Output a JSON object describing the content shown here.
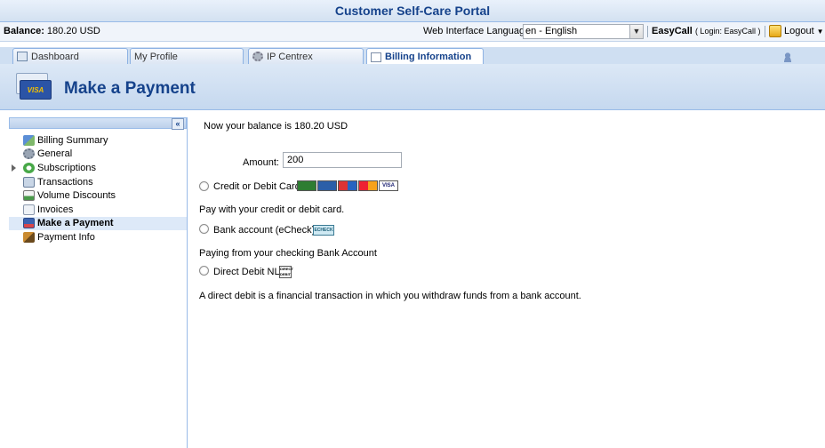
{
  "portal": {
    "title": "Customer Self-Care Portal"
  },
  "infobar": {
    "balance_label": "Balance:",
    "balance_value": "180.20 USD",
    "language_label": "Web Interface Language:",
    "language_value": "en - English",
    "account_name": "EasyCall",
    "login_text": "( Login: EasyCall )",
    "logout_label": "Logout"
  },
  "tabs": [
    {
      "label": "Dashboard",
      "icon": "dashboard-icon"
    },
    {
      "label": "My Profile",
      "icon": "user-icon"
    },
    {
      "label": "IP Centrex",
      "icon": "gear-icon"
    },
    {
      "label": "Billing Information",
      "icon": "document-icon",
      "active": true
    }
  ],
  "header": {
    "title": "Make a Payment",
    "icon": "visa-card-icon"
  },
  "sidebar": {
    "collapse_label": "«",
    "items": [
      {
        "label": "Billing Summary",
        "icon": "chart-icon"
      },
      {
        "label": "General",
        "icon": "gear-icon"
      },
      {
        "label": "Subscriptions",
        "icon": "refresh-icon",
        "expandable": true
      },
      {
        "label": "Transactions",
        "icon": "transactions-icon"
      },
      {
        "label": "Volume Discounts",
        "icon": "discount-icon"
      },
      {
        "label": "Invoices",
        "icon": "invoice-icon"
      },
      {
        "label": "Make a Payment",
        "icon": "payment-icon",
        "active": true
      },
      {
        "label": "Payment Info",
        "icon": "payment-info-icon"
      }
    ]
  },
  "main": {
    "balance_text": "Now your balance is 180.20 USD",
    "amount_label": "Amount:",
    "amount_value": "200",
    "options": [
      {
        "label": "Credit or Debit Card",
        "description": "Pay with your credit or debit card."
      },
      {
        "label": "Bank account (eCheck)",
        "description": "Paying from your checking Bank Account"
      },
      {
        "label": "Direct Debit NL",
        "description": "A direct debit is a financial transaction in which you withdraw funds from a bank account."
      }
    ],
    "card_logos": [
      "card-icon",
      "amex-icon",
      "maestro-icon",
      "mastercard-icon",
      "visa-icon"
    ],
    "echeck_logo": "ECHECK",
    "direct_debit_logo": "DIRECT DEBIT"
  },
  "colors": {
    "title_blue": "#15428b",
    "panel_border": "#99bbe8"
  }
}
